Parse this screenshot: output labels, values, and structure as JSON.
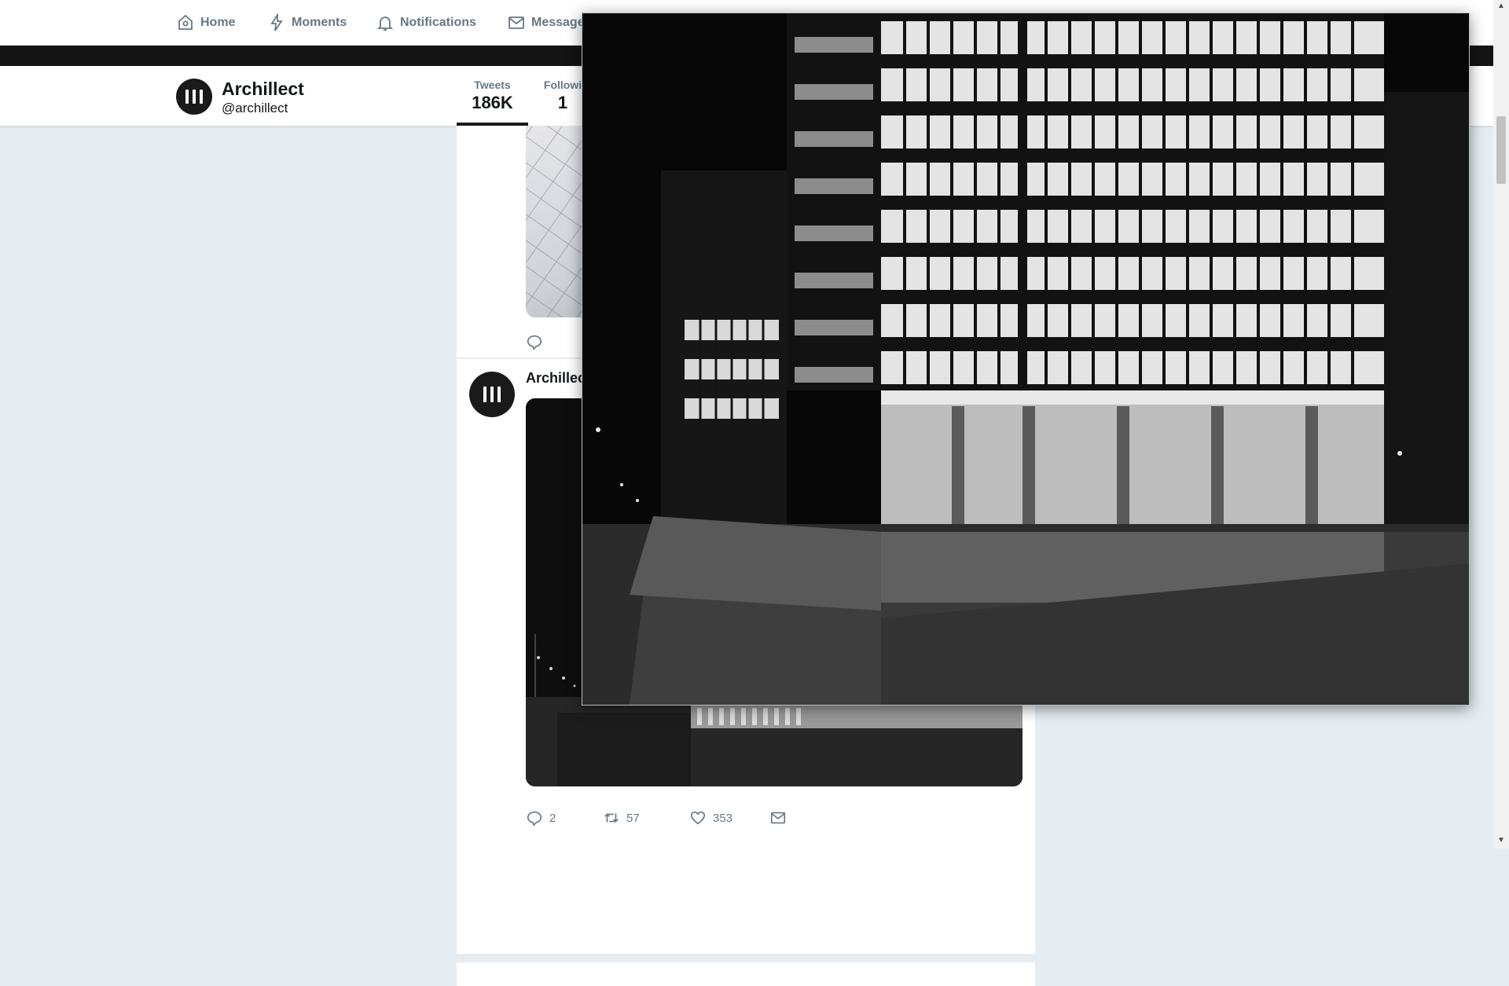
{
  "nav": {
    "home": "Home",
    "moments": "Moments",
    "notifications": "Notifications",
    "messages": "Messages"
  },
  "profile": {
    "name": "Archillect",
    "handle": "@archillect",
    "stats": [
      {
        "label": "Tweets",
        "value": "186K"
      },
      {
        "label": "Followi",
        "value": "1"
      }
    ]
  },
  "tweet": {
    "author": "Archillect",
    "replies": "2",
    "retweets": "57",
    "likes": "353"
  },
  "icons": [
    "home-icon",
    "moments-icon",
    "notifications-icon",
    "messages-icon",
    "reply-icon",
    "retweet-icon",
    "like-icon",
    "dm-icon"
  ],
  "colors": {
    "accent": "#1a1a1a",
    "background": "#e6ecf0",
    "muted": "#657786"
  }
}
